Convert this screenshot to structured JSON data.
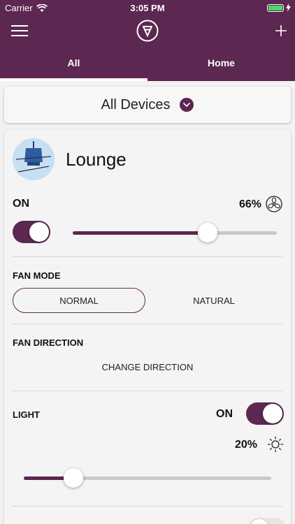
{
  "status_bar": {
    "carrier": "Carrier",
    "time": "3:05 PM"
  },
  "header": {
    "tabs": [
      {
        "label": "All",
        "active": true
      },
      {
        "label": "Home",
        "active": false
      }
    ]
  },
  "device_filter": {
    "selected": "All Devices"
  },
  "device": {
    "name": "Lounge",
    "power": {
      "label": "ON",
      "on": true
    },
    "speed": {
      "percent_label": "66%",
      "value_percent": 66
    },
    "fan_mode": {
      "title": "FAN MODE",
      "options": [
        "NORMAL",
        "NATURAL"
      ],
      "selected": "NORMAL"
    },
    "fan_direction": {
      "title": "FAN DIRECTION",
      "action": "CHANGE DIRECTION"
    },
    "light": {
      "title": "LIGHT",
      "state_label": "ON",
      "on": true,
      "brightness_label": "20%",
      "brightness_percent": 20
    }
  },
  "colors": {
    "brand": "#5c2750",
    "battery": "#4cd964",
    "track": "#c9c9c9"
  },
  "icons": [
    "wifi-icon",
    "battery-icon",
    "menu-icon",
    "logo-icon",
    "plus-icon",
    "chevron-down-icon",
    "fan-icon",
    "sun-icon"
  ]
}
